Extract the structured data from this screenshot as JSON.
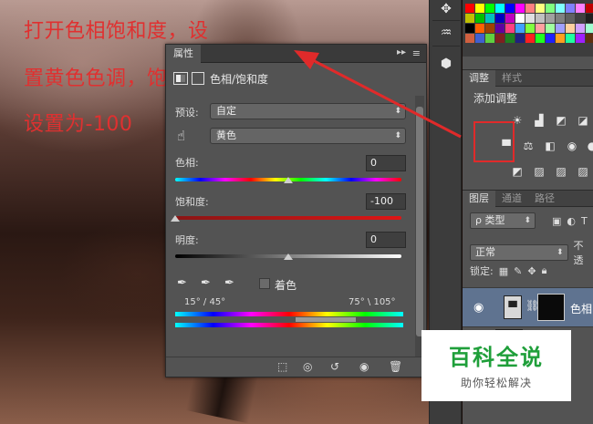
{
  "annotation": {
    "line1": "打开色相饱和度，设",
    "line2": "置黄色色调，饱和度",
    "line3": "设置为-100"
  },
  "properties_panel": {
    "tab_label": "属性",
    "title": "色相/饱和度",
    "preset_label": "预设:",
    "preset_value": "自定",
    "channel_value": "黄色",
    "hue": {
      "label": "色相:",
      "value": "0",
      "level": 0.5
    },
    "saturation": {
      "label": "饱和度:",
      "value": "-100",
      "level": 0.0
    },
    "lightness": {
      "label": "明度:",
      "value": "0",
      "level": 0.5
    },
    "colorize_label": "着色",
    "range_left": "15° / 45°",
    "range_right": "75° \\ 105°"
  },
  "right_panel": {
    "adjust_tabs": [
      "调整",
      "样式"
    ],
    "adjust_title": "添加调整",
    "layer_tabs": [
      "图层",
      "通道",
      "路径"
    ],
    "filter_kind": "ρ 类型",
    "blend_mode": "正常",
    "opacity_label": "不透",
    "lock_label": "锁定:",
    "layer_name": "色相"
  },
  "watermark": {
    "title": "百科全说",
    "subtitle": "助你轻松解决"
  },
  "colors": {
    "annotation_red": "#e03030",
    "panel_bg": "#535353",
    "watermark_green": "#1f9f3a"
  },
  "swatch_colors": [
    "#ff0000",
    "#ffff00",
    "#00ff00",
    "#00ffff",
    "#0000ff",
    "#ff00ff",
    "#ff8080",
    "#ffff80",
    "#80ff80",
    "#80ffff",
    "#8080ff",
    "#ff80ff",
    "#c00000",
    "#c0c000",
    "#00c000",
    "#00c0c0",
    "#0000c0",
    "#c000c0",
    "#ffffff",
    "#e0e0e0",
    "#c0c0c0",
    "#a0a0a0",
    "#808080",
    "#606060",
    "#404040",
    "#202020",
    "#000000",
    "#ff6000",
    "#a04000",
    "#6000a0",
    "#ff4080",
    "#40a0ff",
    "#80ff40",
    "#ffa0a0",
    "#a0ffa0",
    "#a0a0ff",
    "#ffd0a0",
    "#d0a0ff",
    "#a0ffd0",
    "#d06040",
    "#4060d0",
    "#60d040",
    "#802020",
    "#208020",
    "#202080",
    "#ff2020",
    "#20ff20",
    "#2020ff",
    "#ffa020",
    "#20ffa0",
    "#a020ff",
    "#603010"
  ]
}
